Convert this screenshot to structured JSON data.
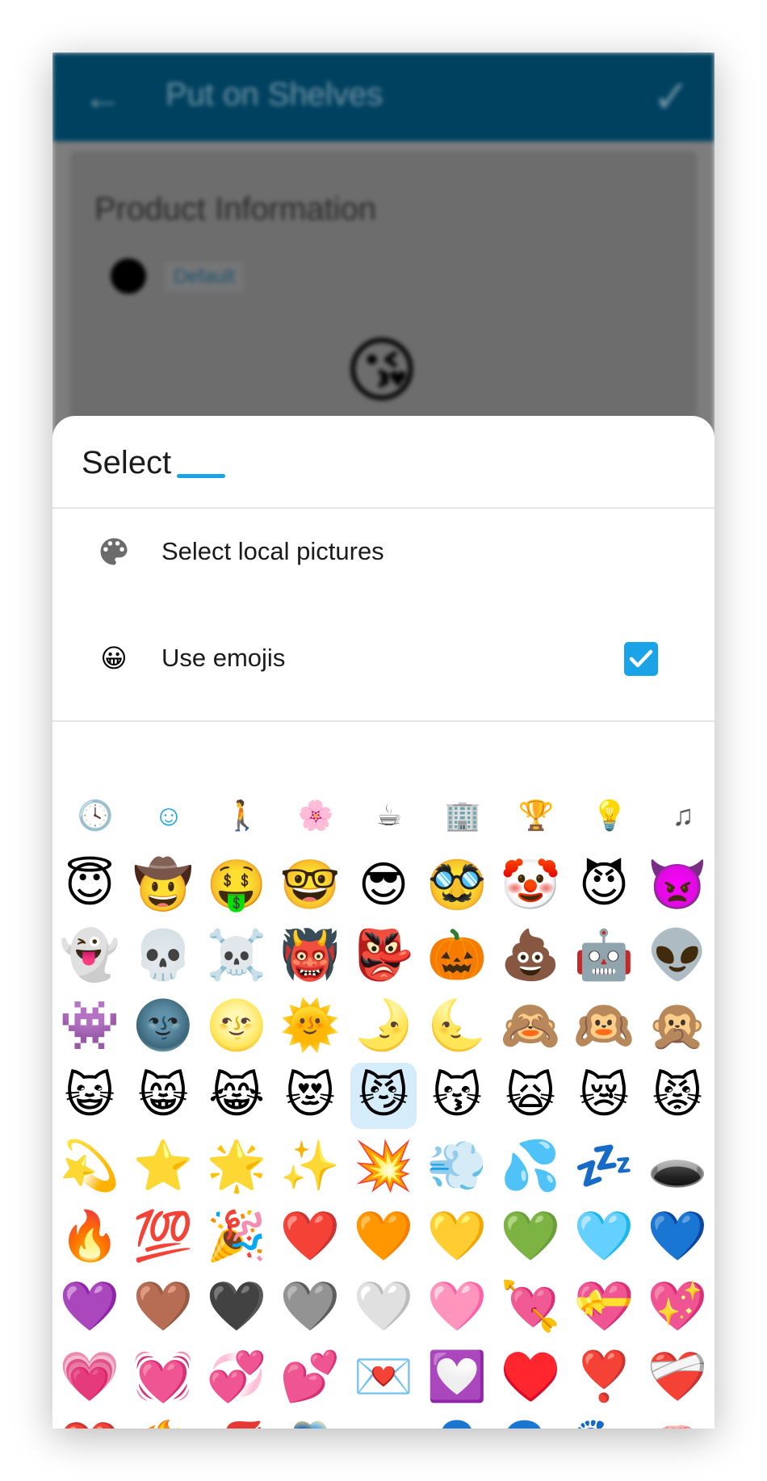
{
  "app_bar": {
    "back_icon": "arrow-back-icon",
    "title": "Put on Shelves",
    "confirm_icon": "check-icon",
    "color": "#004b6e"
  },
  "background": {
    "section_title": "Product Information",
    "default_label": "Default",
    "preview_emoji": "😘"
  },
  "sheet": {
    "title": "Select",
    "options": [
      {
        "label": "Select local pictures",
        "icon": "palette-icon"
      },
      {
        "label": "Use emojis",
        "icon": "grinning-face-icon",
        "checked": true
      }
    ],
    "accent": "#1ba3e8"
  },
  "categories": [
    {
      "name": "recent",
      "glyph": "🕓"
    },
    {
      "name": "smileys",
      "glyph": "☺",
      "selected": true
    },
    {
      "name": "activity",
      "glyph": "🚶"
    },
    {
      "name": "animals-nature",
      "glyph": "🌸"
    },
    {
      "name": "food-drink",
      "glyph": "☕"
    },
    {
      "name": "travel-places",
      "glyph": "🏢"
    },
    {
      "name": "activities",
      "glyph": "🏆"
    },
    {
      "name": "objects",
      "glyph": "💡"
    },
    {
      "name": "symbols",
      "glyph": "♫"
    }
  ],
  "emoji_rows": [
    [
      "😇",
      "🤠",
      "🤑",
      "🤓",
      "😎",
      "🥸",
      "🤡",
      "😈",
      "👿"
    ],
    [
      "👻",
      "💀",
      "☠️",
      "👹",
      "👺",
      "🎃",
      "💩",
      "🤖",
      "👽"
    ],
    [
      "👾",
      "🌚",
      "🌝",
      "🌞",
      "🌛",
      "🌜",
      "🙈",
      "🙉",
      "🙊"
    ],
    [
      "😺",
      "😸",
      "😹",
      "😻",
      "😼",
      "😽",
      "🙀",
      "😿",
      "😾"
    ],
    [
      "💫",
      "⭐",
      "🌟",
      "✨",
      "💥",
      "💨",
      "💦",
      "💤",
      "🕳️"
    ],
    [
      "🔥",
      "💯",
      "🎉",
      "❤️",
      "🧡",
      "💛",
      "💚",
      "🩵",
      "💙"
    ],
    [
      "💜",
      "🤎",
      "🖤",
      "🩶",
      "🤍",
      "🩷",
      "💘",
      "💝",
      "💖"
    ],
    [
      "💗",
      "💓",
      "💞",
      "💕",
      "💌",
      "💟",
      "♥️",
      "❣️",
      "❤️‍🩹"
    ],
    [
      "💔",
      "❤️‍🔥",
      "💋",
      "🫂",
      "👥",
      "👤",
      "🗣️",
      "👣",
      "🧠"
    ],
    [
      "🩸",
      "🦠",
      "🦷",
      "🦴",
      "👀",
      "👁️",
      "👄",
      "👅",
      "👃"
    ]
  ],
  "selected_emoji": "😼"
}
